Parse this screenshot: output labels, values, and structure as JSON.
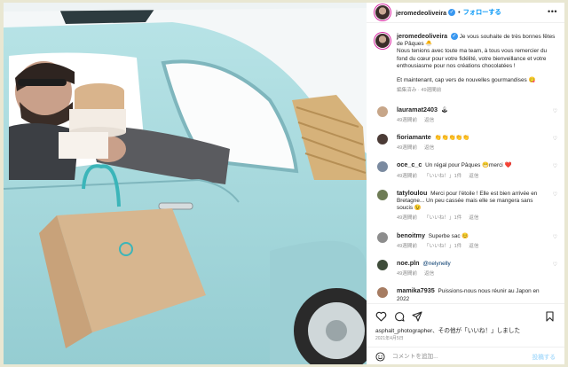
{
  "header": {
    "username": "jeromedeoliveira",
    "follow_label": "フォローする"
  },
  "caption": {
    "username": "jeromedeoliveira",
    "line1": "Je vous souhaite de très bonnes fêtes de Pâques 🐣",
    "line2": "Nous tenions avec toute ma team, à tous vous remercier du fond du cœur pour votre fidélité, votre bienveillance et votre enthousiasme pour nos créations chocolatées !",
    "line3": "Et maintenant, cap vers de nouvelles gourmandises 😋",
    "edited": "編集済み · 49週間前"
  },
  "comments": [
    {
      "user": "lauramat2403",
      "text": "🕹",
      "time": "49週間前",
      "reply": "返信",
      "likes": "",
      "avatar": "#c7a689"
    },
    {
      "user": "fioriamante",
      "text": "👏👏👏👏👏",
      "time": "49週間前",
      "reply": "返信",
      "likes": "",
      "avatar": "#4b3b36"
    },
    {
      "user": "oce_c_c",
      "text": "Un régal pour Pâques 😁merci ❤️",
      "time": "49週間前",
      "reply": "返信",
      "likes": "「いいね！」1件",
      "avatar": "#7a8aa0"
    },
    {
      "user": "tatyloulou",
      "text": "Merci pour l'étoile ! Elle est bien arrivée en Bretagne... Un peu cassée mais elle se mangera sans soucis 😉",
      "time": "49週間前",
      "reply": "返信",
      "likes": "「いいね！」1件",
      "avatar": "#6e7c55"
    },
    {
      "user": "benoitmy",
      "text": "Superbe sac 😊",
      "time": "49週間前",
      "reply": "返信",
      "likes": "「いいね！」1件",
      "avatar": "#8d8d8d"
    },
    {
      "user": "noe.pln",
      "mention": "@nelynelly",
      "text": "",
      "time": "49週間前",
      "reply": "返信",
      "likes": "",
      "avatar": "#3f4d3a"
    },
    {
      "user": "mamika7935",
      "text": "Puissions-nous nous réunir au Japon en 2022",
      "time": "",
      "reply": "",
      "likes": "",
      "avatar": "#a67c62"
    }
  ],
  "likes_text": "asphalt_photographer、その他が「いいね！」しました",
  "date": "2021年4月5日",
  "add_comment": {
    "placeholder": "コメントを追加...",
    "post_label": "投稿する"
  },
  "icons": [
    "heart-icon",
    "comment-icon",
    "share-icon",
    "bookmark-icon",
    "emoji-icon",
    "verified-icon",
    "more-icon"
  ],
  "colors": {
    "accent": "#0095f6",
    "car": "#a8d8dc"
  }
}
